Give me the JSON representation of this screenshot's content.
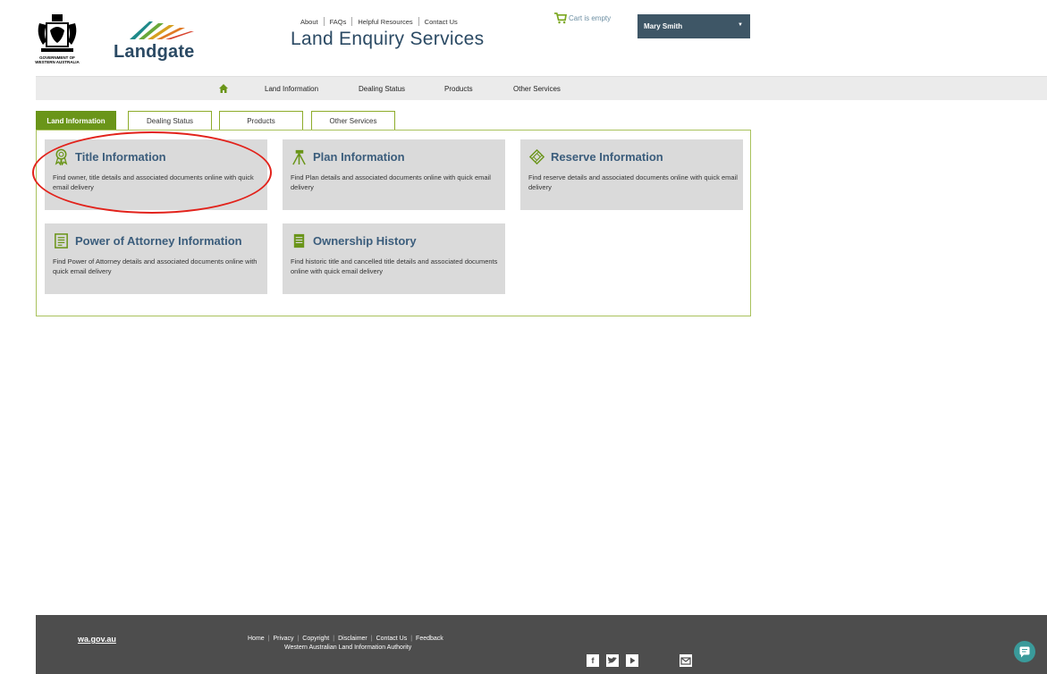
{
  "header": {
    "crest_caption": "GOVERNMENT OF WESTERN AUSTRALIA",
    "brand": "Landgate",
    "top_links": [
      "About",
      "FAQs",
      "Helpful Resources",
      "Contact Us"
    ],
    "site_title": "Land Enquiry Services",
    "cart": "Cart is empty",
    "user": "Mary Smith"
  },
  "nav": {
    "items": [
      "Land Information",
      "Dealing Status",
      "Products",
      "Other Services"
    ]
  },
  "tabs": [
    {
      "label": "Land Information",
      "active": true
    },
    {
      "label": "Dealing Status",
      "active": false
    },
    {
      "label": "Products",
      "active": false
    },
    {
      "label": "Other Services",
      "active": false
    }
  ],
  "cards": [
    {
      "title": "Title Information",
      "desc": "Find owner, title details and associated documents online with quick email delivery",
      "icon": "ribbon-icon"
    },
    {
      "title": "Plan Information",
      "desc": "Find Plan details and associated documents online with quick email delivery",
      "icon": "surveyor-icon"
    },
    {
      "title": "Reserve Information",
      "desc": "Find reserve details and associated documents online with quick email delivery",
      "icon": "map-icon"
    },
    {
      "title": "Power of Attorney Information",
      "desc": "Find Power of Attorney details and associated documents online with quick email delivery",
      "icon": "document-icon"
    },
    {
      "title": "Ownership History",
      "desc": "Find historic title and cancelled title details and associated documents online with quick email delivery",
      "icon": "history-icon"
    }
  ],
  "footer": {
    "wa_link": "wa.gov.au",
    "links": [
      "Home",
      "Privacy",
      "Copyright",
      "Disclaimer",
      "Contact Us",
      "Feedback"
    ],
    "org": "Western Australian Land Information Authority",
    "social": [
      "facebook-icon",
      "twitter-icon",
      "youtube-icon",
      "email-icon"
    ]
  },
  "colors": {
    "brand_green": "#6a9519",
    "title_blue": "#3b5d7c",
    "highlight_red": "#e2221b",
    "footer_bg": "#4d4d4d"
  }
}
